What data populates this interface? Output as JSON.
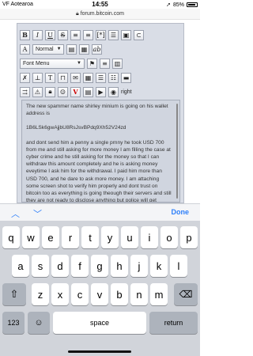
{
  "status": {
    "carrier": "VF Aotearoa",
    "time": "14:55",
    "battery": "85%"
  },
  "url": "forum.bitcoin.com",
  "toolbar": {
    "font_size_select": "Normal",
    "font_menu_select": "Font Menu",
    "right_label": "right"
  },
  "editor_text": {
    "p1": "The new spammer name shirley minium is going on his wallet address is",
    "p2": "1B6LSk6gwAjjbU8RsJsvBPdq9Xh52V24zd",
    "p3": "and dont send him a penny a single prnny he took USD 700 from me and still asking for more money I am filling the case at cyber crime and he still asking for the money so that I can withdraw this amount completely and he is asking money eveytime I ask him for the withdrawal. I paid him more than USD 700, and he dare to ask more money. I am attaching some screen shot to verify him properly and dont trust on bitcoin too as everything is going theough their servers and still they are not ready to disclose anything but police will get"
  },
  "accessory": {
    "done": "Done"
  },
  "keyboard": {
    "row1": [
      "q",
      "w",
      "e",
      "r",
      "t",
      "y",
      "u",
      "i",
      "o",
      "p"
    ],
    "row2": [
      "a",
      "s",
      "d",
      "f",
      "g",
      "h",
      "j",
      "k",
      "l"
    ],
    "row3": [
      "z",
      "x",
      "c",
      "v",
      "b",
      "n",
      "m"
    ],
    "numbers": "123",
    "space": "space",
    "return": "return"
  },
  "colors": {
    "accent": "#2d7ff9",
    "keyboard_bg": "#d1d4da",
    "editor_bg": "#d9dde6"
  }
}
